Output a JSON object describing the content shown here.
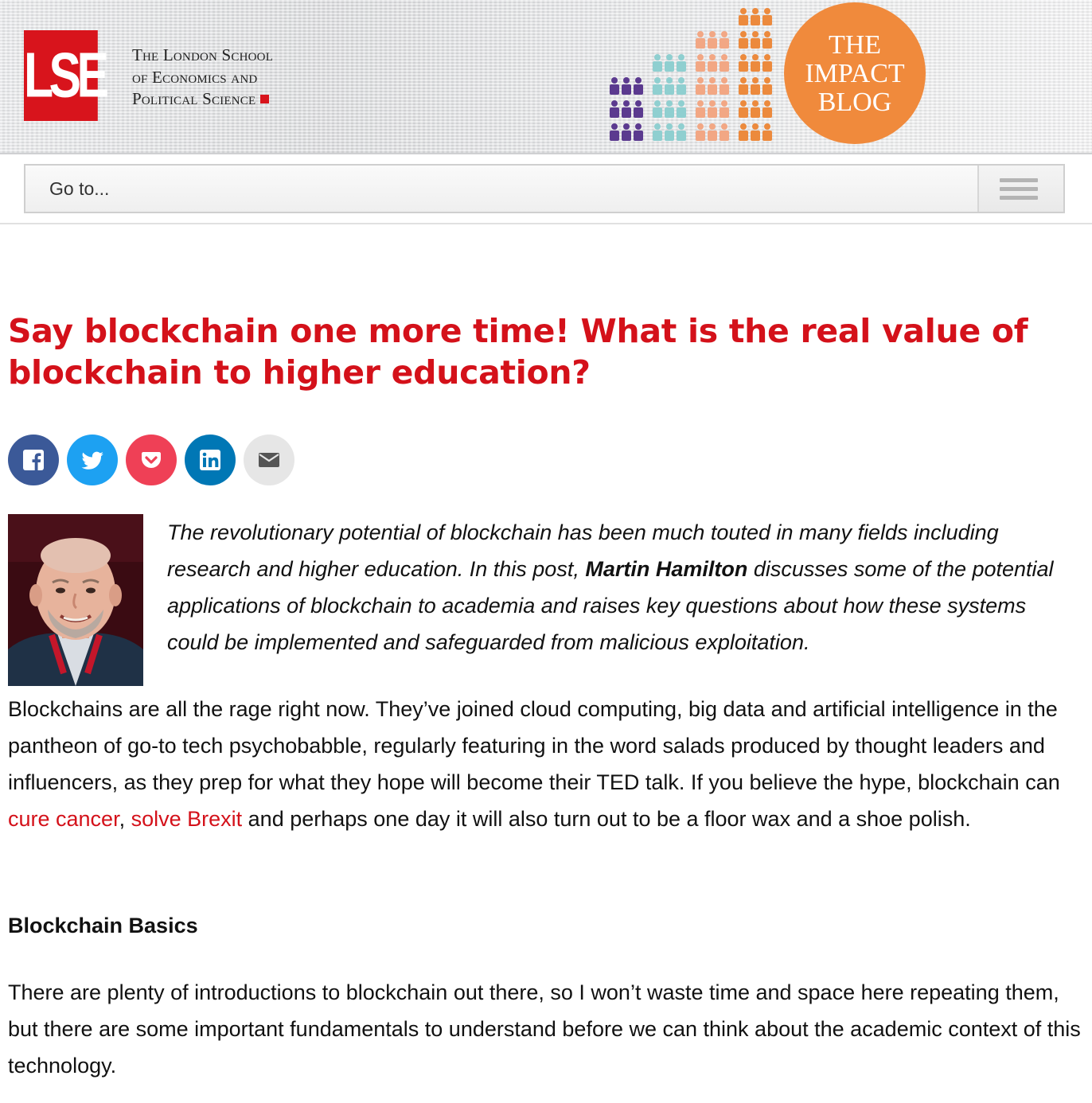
{
  "header": {
    "logo_text": "LSE",
    "school_name_lines": [
      "The London School",
      "of Economics and",
      "Political Science"
    ],
    "blog_badge_lines": [
      "THE",
      "IMPACT",
      "BLOG"
    ],
    "colors": {
      "lse_red": "#d8141c",
      "badge_orange": "#f08a3c",
      "people_purple": "#5b3a8f",
      "people_teal": "#8fcfd0",
      "people_peach": "#f2a784",
      "people_orange": "#ec8a3d"
    }
  },
  "nav": {
    "goto_label": "Go to...",
    "menu_icon": "hamburger-menu-icon"
  },
  "article": {
    "title": "Say blockchain one more time! What is the real value of blockchain to higher education?",
    "share_buttons": [
      {
        "name": "facebook",
        "icon": "facebook-icon",
        "color": "#3b5998"
      },
      {
        "name": "twitter",
        "icon": "twitter-icon",
        "color": "#1da1f2"
      },
      {
        "name": "pocket",
        "icon": "pocket-icon",
        "color": "#ef4056"
      },
      {
        "name": "linkedin",
        "icon": "linkedin-icon",
        "color": "#0077b5"
      },
      {
        "name": "email",
        "icon": "email-icon",
        "color": "#e6e6e6"
      }
    ],
    "standfirst": {
      "before": "The revolutionary potential of blockchain has been much touted in many fields including research and higher education. In this post, ",
      "author": "Martin Hamilton",
      "after": " discusses some of the potential applications of blockchain to academia and raises key questions about how these systems could be implemented and safeguarded from malicious exploitation."
    },
    "paragraph1": {
      "before": "Blockchains are all the rage right now. They’ve joined cloud computing, big data and artificial intelligence in the pantheon of go-to tech psychobabble, regularly featuring in the word salads produced by thought leaders and influencers, as they prep for what they hope will become their TED talk. If you believe the hype, blockchain can ",
      "link1": "cure cancer",
      "between": ", ",
      "link2": "solve Brexit",
      "after": " and perhaps one day it will also turn out to be a floor wax and a shoe polish."
    },
    "heading1": "Blockchain Basics",
    "paragraph2": "There are plenty of introductions to blockchain out there, so I won’t waste time and space here repeating them, but there are some important fundamentals to understand before we can think about the academic context of this technology."
  }
}
